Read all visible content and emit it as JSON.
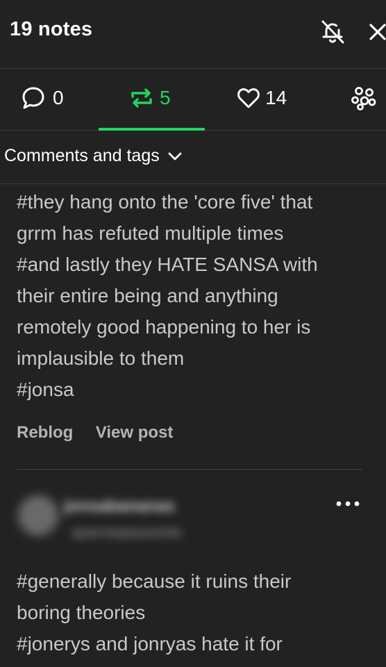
{
  "header": {
    "title": "19 notes",
    "icons": {
      "notifications": "bell-off-icon",
      "close": "close-icon"
    }
  },
  "tabs": {
    "replies": {
      "icon": "comment-icon",
      "count": "0"
    },
    "reblogs": {
      "icon": "reblog-icon",
      "count": "5",
      "active": true
    },
    "likes": {
      "icon": "heart-icon",
      "count": "14"
    },
    "community": {
      "icon": "community-icon"
    }
  },
  "filter": {
    "label": "Comments and tags",
    "icon": "chevron-down-icon"
  },
  "posts": [
    {
      "body_lines": [
        "#they hang onto the 'core five' that",
        "grrm has refuted multiple times",
        "#and lastly they HATE SANSA with",
        "their entire being and anything",
        "remotely good happening to her is",
        "implausible to them",
        "#jonsa"
      ],
      "actions": {
        "reblog": "Reblog",
        "view_post": "View post"
      }
    },
    {
      "author": "jonsabananas",
      "subline": "sparrowpassonto",
      "more_icon": "more-icon",
      "body_lines": [
        "#generally because it ruins their",
        "boring theories",
        "#jonerys and jonryas hate it for"
      ]
    }
  ],
  "colors": {
    "background": "#222222",
    "accent_green": "#1ed760",
    "text": "#ffffff",
    "body_text": "#c9c9c9",
    "divider": "#3c3c3c"
  }
}
